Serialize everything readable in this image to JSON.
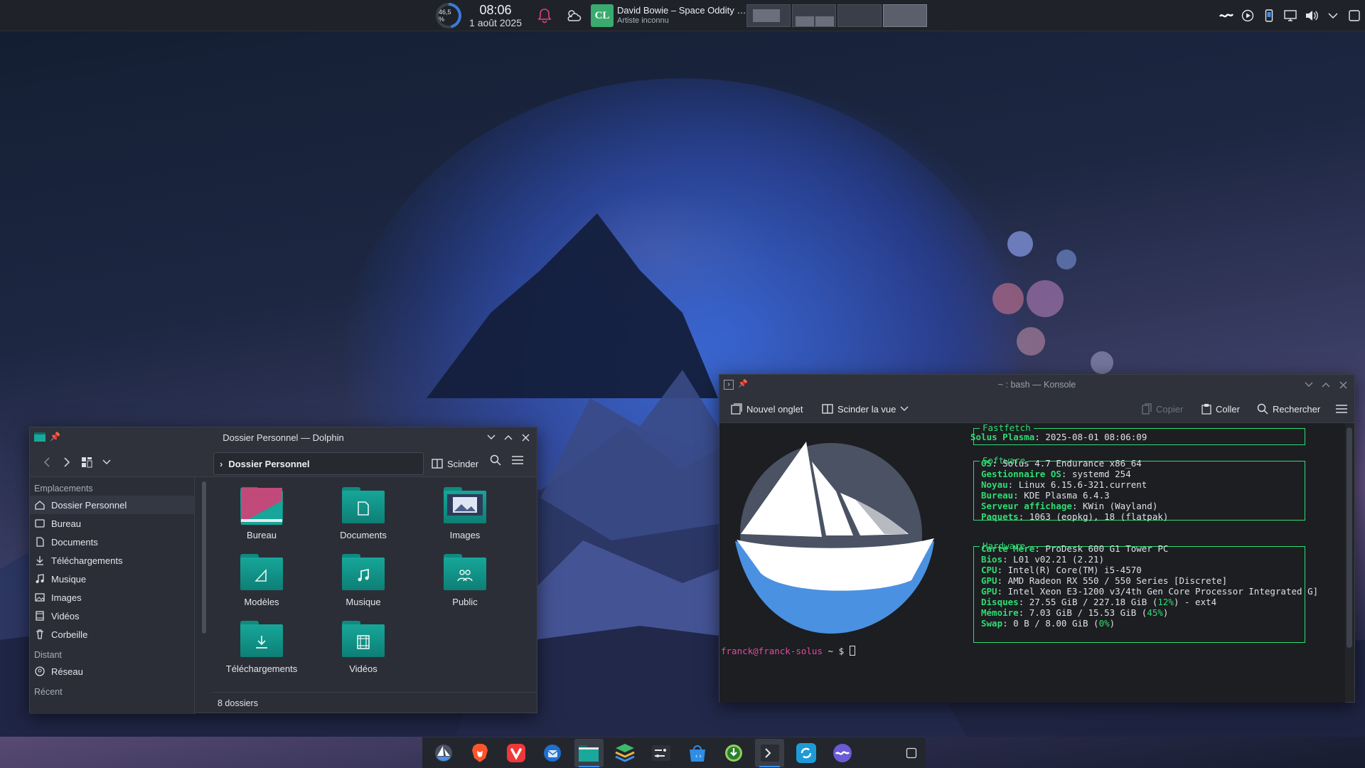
{
  "topbar": {
    "cpu_percent_label": "46,5 %",
    "cpu_value": 46.5,
    "clock_time": "08:06",
    "clock_date": "1 août 2025",
    "media": {
      "cover_initials": "CL",
      "title": "David Bowie – Space Oddity …",
      "artist": "Artiste inconnu"
    },
    "pager_count": 4,
    "tray_icons": [
      "kdeconnect-wave-icon",
      "media-play-icon",
      "phone-icon",
      "display-icon",
      "volume-icon",
      "chevron-down-icon",
      "show-desktop-icon"
    ]
  },
  "dolphin": {
    "title": "Dossier Personnel — Dolphin",
    "breadcrumb": "Dossier Personnel",
    "split_label": "Scinder",
    "places_header": "Emplacements",
    "places": [
      {
        "label": "Dossier Personnel",
        "icon": "home-icon"
      },
      {
        "label": "Bureau",
        "icon": "desktop-icon"
      },
      {
        "label": "Documents",
        "icon": "document-icon"
      },
      {
        "label": "Téléchargements",
        "icon": "download-icon"
      },
      {
        "label": "Musique",
        "icon": "music-icon"
      },
      {
        "label": "Images",
        "icon": "image-icon"
      },
      {
        "label": "Vidéos",
        "icon": "video-icon"
      },
      {
        "label": "Corbeille",
        "icon": "trash-icon"
      }
    ],
    "remote_header": "Distant",
    "remote": [
      {
        "label": "Réseau",
        "icon": "network-icon"
      }
    ],
    "recent_header": "Récent",
    "folders": [
      "Bureau",
      "Documents",
      "Images",
      "Modèles",
      "Musique",
      "Public",
      "Téléchargements",
      "Vidéos"
    ],
    "status": "8 dossiers"
  },
  "konsole": {
    "title": "~ : bash — Konsole",
    "new_tab": "Nouvel onglet",
    "split_view": "Scinder la vue",
    "copy": "Copier",
    "paste": "Coller",
    "search": "Rechercher",
    "fastfetch": {
      "header": "Fastfetch",
      "host_line_key": "Solus Plasma",
      "host_line_val": ": 2025-08-01 08:06:09",
      "software_header": "Software",
      "software": [
        {
          "k": "OS",
          "v": ": Solus 4.7 Endurance x86_64"
        },
        {
          "k": "Gestionnaire OS",
          "v": ": systemd 254"
        },
        {
          "k": "Noyau",
          "v": ": Linux 6.15.6-321.current"
        },
        {
          "k": "Bureau",
          "v": ": KDE Plasma 6.4.3"
        },
        {
          "k": "Serveur affichage",
          "v": ": KWin (Wayland)"
        },
        {
          "k": "Paquets",
          "v": ": 1063 (eopkg), 18 (flatpak)"
        }
      ],
      "hardware_header": "Hardware",
      "hardware": [
        {
          "k": "Carte Mère",
          "v": ": ProDesk 600 G1 Tower PC"
        },
        {
          "k": "Bios",
          "v": ": L01 v02.21 (2.21)"
        },
        {
          "k": "CPU",
          "v": ": Intel(R) Core(TM) i5-4570"
        },
        {
          "k": "GPU",
          "v": ": AMD Radeon RX 550 / 550 Series [Discrete]"
        },
        {
          "k": "GPU",
          "v": ": Intel Xeon E3-1200 v3/4th Gen Core Processor Integrated G]"
        },
        {
          "k": "Disques",
          "v": ": 27.55 GiB / 227.18 GiB (",
          "p": "12%",
          "e": ") - ext4"
        },
        {
          "k": "Mémoire",
          "v": ": 7.03 GiB / 15.53 GiB (",
          "p": "45%",
          "e": ")"
        },
        {
          "k": "Swap",
          "v": ": 0 B / 8.00 GiB (",
          "p": "0%",
          "e": ")"
        }
      ]
    },
    "prompt_user": "franck@franck-solus",
    "prompt_rest": " ~ $ "
  },
  "dock": {
    "apps": [
      "solus-icon",
      "brave-icon",
      "vivaldi-icon",
      "thunderbird-icon",
      "dolphin-icon",
      "stack-icon",
      "settings-terminal-icon",
      "discover-icon",
      "download-manager-icon",
      "konsole-icon",
      "sync-icon",
      "wave-app-icon"
    ],
    "active": [
      "dolphin-icon",
      "konsole-icon"
    ]
  },
  "colors": {
    "accent": "#3d8ee6",
    "folder": "#17a699",
    "terminal_green": "#2fdc73",
    "prompt_pink": "#e34aa6"
  }
}
